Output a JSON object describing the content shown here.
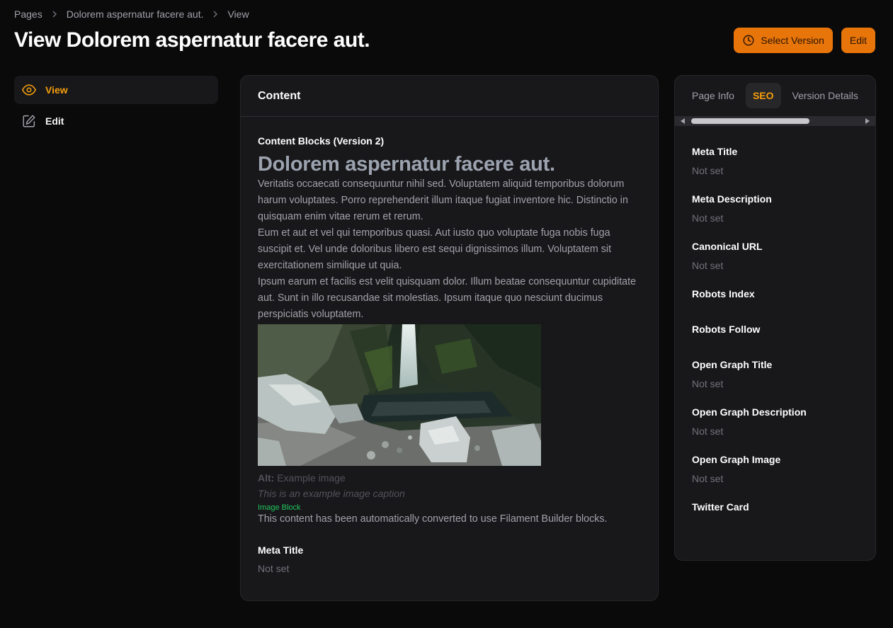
{
  "breadcrumb": [
    "Pages",
    "Dolorem aspernatur facere aut.",
    "View"
  ],
  "page_title": "View Dolorem aspernatur facere aut.",
  "actions": {
    "select_version": "Select Version",
    "edit": "Edit"
  },
  "nav": [
    {
      "label": "View",
      "icon": "eye-icon",
      "active": true
    },
    {
      "label": "Edit",
      "icon": "pencil-square-icon",
      "active": false
    }
  ],
  "content": {
    "section_title": "Content",
    "blocks_label": "Content Blocks (Version 2)",
    "heading": "Dolorem aspernatur facere aut.",
    "paragraphs": [
      "Veritatis occaecati consequuntur nihil sed. Voluptatem aliquid temporibus dolorum harum voluptates. Porro reprehenderit illum itaque fugiat inventore hic. Distinctio in quisquam enim vitae rerum et rerum.",
      "Eum et aut et vel qui temporibus quasi. Aut iusto quo voluptate fuga nobis fuga suscipit et. Vel unde doloribus libero est sequi dignissimos illum. Voluptatem sit exercitationem similique ut quia.",
      "Ipsum earum et facilis est velit quisquam dolor. Illum beatae consequuntur cupiditate aut. Sunt in illo recusandae sit molestias. Ipsum itaque quo nesciunt ducimus perspiciatis voluptatem."
    ],
    "image_alt_label": "Alt:",
    "image_alt": "Example image",
    "image_caption": "This is an example image caption",
    "block_type": "Image Block",
    "converted_note": "This content has been automatically converted to use Filament Builder blocks.",
    "meta_title_label": "Meta Title",
    "meta_title_value": "Not set"
  },
  "side_tabs": [
    {
      "label": "Page Info",
      "active": false
    },
    {
      "label": "SEO",
      "active": true
    },
    {
      "label": "Version Details",
      "active": false
    }
  ],
  "seo_fields": [
    {
      "label": "Meta Title",
      "value": "Not set"
    },
    {
      "label": "Meta Description",
      "value": "Not set"
    },
    {
      "label": "Canonical URL",
      "value": "Not set"
    },
    {
      "label": "Robots Index",
      "value": ""
    },
    {
      "label": "Robots Follow",
      "value": ""
    },
    {
      "label": "Open Graph Title",
      "value": "Not set"
    },
    {
      "label": "Open Graph Description",
      "value": "Not set"
    },
    {
      "label": "Open Graph Image",
      "value": "Not set"
    },
    {
      "label": "Twitter Card",
      "value": ""
    }
  ],
  "colors": {
    "accent": "#f59e0b",
    "button": "#e8750a",
    "success": "#22c55e"
  }
}
